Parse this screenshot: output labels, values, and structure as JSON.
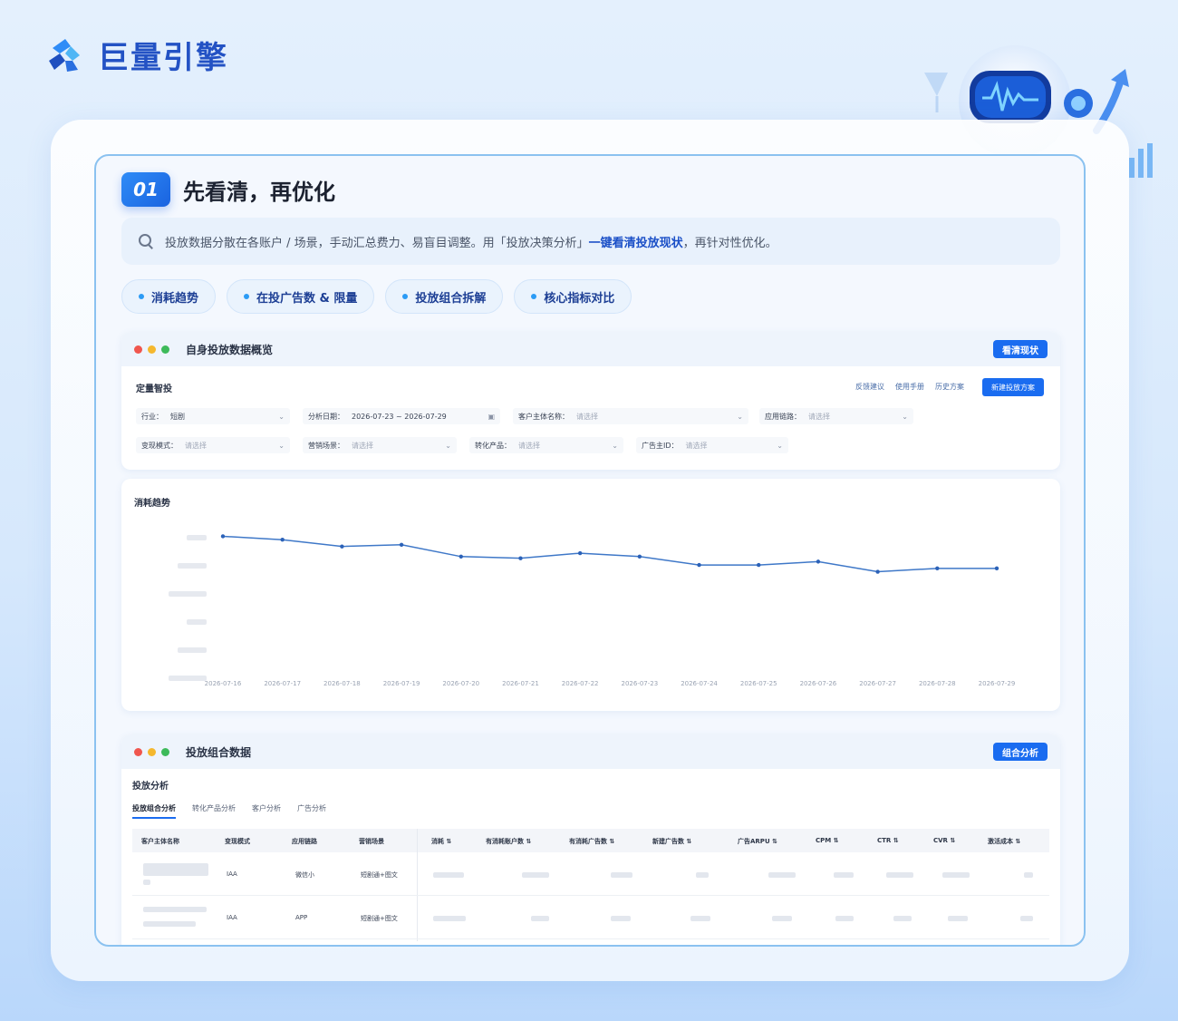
{
  "brand": {
    "name": "巨量引擎"
  },
  "step": {
    "number": "01",
    "title": "先看清，再优化"
  },
  "description": {
    "prefix": "投放数据分散在各账户 / 场景，手动汇总费力、易盲目调整。用「投放决策分析」",
    "highlight": "一键看清投放现状",
    "suffix": "，再针对性优化。"
  },
  "tags": [
    "消耗趋势",
    "在投广告数 & 限量",
    "投放组合拆解",
    "核心指标对比"
  ],
  "overview_panel": {
    "title": "自身投放数据概览",
    "button": "看清现状",
    "filter_title": "定量智投",
    "links": [
      "反馈建议",
      "使用手册",
      "历史方案"
    ],
    "primary_button": "新建投放方案",
    "fields": [
      {
        "label": "行业：",
        "value": "短剧",
        "placeholder": ""
      },
      {
        "label": "分析日期：",
        "value": "2026-07-23 ~ 2026-07-29",
        "placeholder": ""
      },
      {
        "label": "客户主体名称：",
        "value": "",
        "placeholder": "请选择"
      },
      {
        "label": "应用链路：",
        "value": "",
        "placeholder": "请选择"
      },
      {
        "label": "变现模式：",
        "value": "",
        "placeholder": "请选择"
      },
      {
        "label": "营销场景：",
        "value": "",
        "placeholder": "请选择"
      },
      {
        "label": "转化产品：",
        "value": "",
        "placeholder": "请选择"
      },
      {
        "label": "广告主ID：",
        "value": "",
        "placeholder": "请选择"
      }
    ]
  },
  "chart_data": {
    "type": "line",
    "title": "消耗趋势",
    "categories": [
      "2026-07-16",
      "2026-07-17",
      "2026-07-18",
      "2026-07-19",
      "2026-07-20",
      "2026-07-21",
      "2026-07-22",
      "2026-07-23",
      "2026-07-24",
      "2026-07-25",
      "2026-07-26",
      "2026-07-27",
      "2026-07-28",
      "2026-07-29"
    ],
    "series": [
      {
        "values": [
          82,
          80,
          76,
          77,
          70,
          69,
          72,
          70,
          65,
          65,
          67,
          61,
          63,
          63
        ]
      }
    ],
    "ylim": [
      0,
      100
    ],
    "grid": false,
    "color": "#3f78c8"
  },
  "combo_panel": {
    "title": "投放组合数据",
    "button": "组合分析",
    "sub_title": "投放分析",
    "tabs": [
      "投放组合分析",
      "转化产品分析",
      "客户分析",
      "广告分析"
    ],
    "columns": [
      "客户主体名称",
      "变现模式",
      "应用链路",
      "营销场景",
      "消耗 ⇅",
      "有消耗账户数 ⇅",
      "有消耗广告数 ⇅",
      "新建广告数 ⇅",
      "广告ARPU ⇅",
      "CPM ⇅",
      "CTR ⇅",
      "CVR ⇅",
      "激活成本 ⇅"
    ],
    "rows": [
      [
        "",
        "IAA",
        "微信小",
        "短剧通+图文"
      ],
      [
        "",
        "IAA",
        "APP",
        "短剧通+图文"
      ]
    ]
  },
  "colors": {
    "accent": "#1a6cf0",
    "brand": "#2352c4",
    "dot_red": "#f0564e",
    "dot_yellow": "#f5b82e",
    "dot_green": "#3dba5a"
  }
}
